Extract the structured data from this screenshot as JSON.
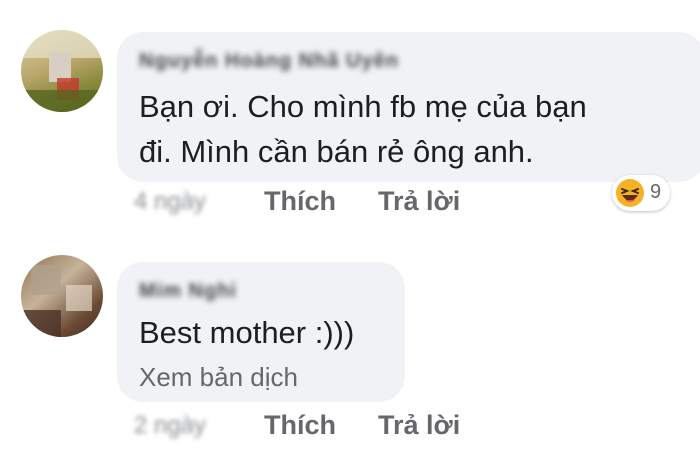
{
  "comments": [
    {
      "author": "Nguyễn Hoàng Nhã Uyên",
      "text_line1": "Bạn ơi. Cho mình fb mẹ của bạn",
      "text_line2": "đi. Mình cần bán rẻ ông anh.",
      "timestamp": "4 ngày",
      "like_label": "Thích",
      "reply_label": "Trả lời",
      "reaction": {
        "icon": "haha-emoji-icon",
        "count": "9"
      }
    },
    {
      "author": "Mim Nghi",
      "text": "Best mother :)))",
      "translate_label": "Xem bản dịch",
      "timestamp": "2 ngày",
      "like_label": "Thích",
      "reply_label": "Trả lời"
    }
  ],
  "colors": {
    "bubble": "#f0f2f5",
    "text": "#1c1e21",
    "secondary": "#65676b",
    "reaction_yellow": "#f7b125"
  }
}
